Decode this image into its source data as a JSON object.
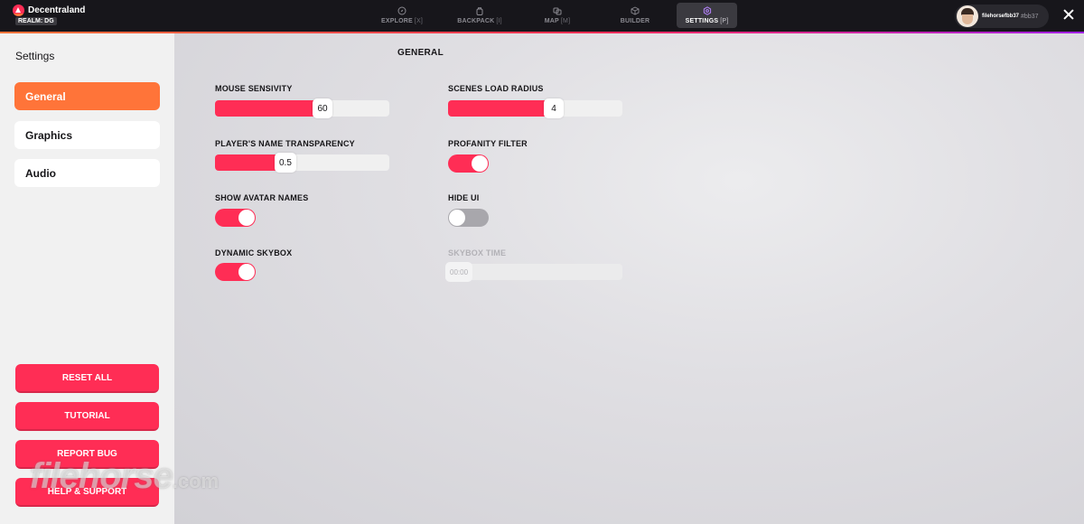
{
  "topbar": {
    "app_name": "Decentraland",
    "realm": "REALM: DG",
    "tabs": [
      {
        "label": "EXPLORE",
        "hotkey": "[X]",
        "icon": "compass-icon"
      },
      {
        "label": "BACKPACK",
        "hotkey": "[I]",
        "icon": "backpack-icon"
      },
      {
        "label": "MAP",
        "hotkey": "[M]",
        "icon": "map-icon"
      },
      {
        "label": "BUILDER",
        "hotkey": "",
        "icon": "cube-icon"
      },
      {
        "label": "SETTINGS",
        "hotkey": "[P]",
        "icon": "gear-icon",
        "active": true
      }
    ],
    "user": {
      "name": "filehorsefbb37",
      "tag": "#bb37"
    }
  },
  "sidebar": {
    "title": "Settings",
    "items": [
      {
        "label": "General",
        "active": true
      },
      {
        "label": "Graphics"
      },
      {
        "label": "Audio"
      }
    ],
    "buttons": {
      "reset_all": "RESET ALL",
      "tutorial": "TUTORIAL",
      "report_bug": "REPORT BUG",
      "help_support": "HELP & SUPPORT"
    }
  },
  "general": {
    "title": "GENERAL",
    "mouse_sensivity": {
      "label": "MOUSE SENSIVITY",
      "value": "60",
      "fraction": 0.57
    },
    "scenes_load_radius": {
      "label": "SCENES LOAD RADIUS",
      "value": "4",
      "fraction": 0.56
    },
    "name_transparency": {
      "label": "PLAYER'S NAME TRANSPARENCY",
      "value": "0.5",
      "fraction": 0.35
    },
    "profanity_filter": {
      "label": "PROFANITY FILTER",
      "on": true
    },
    "show_avatar_names": {
      "label": "SHOW AVATAR NAMES",
      "on": true
    },
    "hide_ui": {
      "label": "HIDE UI",
      "on": false
    },
    "dynamic_skybox": {
      "label": "DYNAMIC SKYBOX",
      "on": true
    },
    "skybox_time": {
      "label": "SKYBOX TIME",
      "value": "00:00",
      "disabled": true
    }
  },
  "watermark": {
    "main": "filehorse",
    "sub": ".com"
  },
  "colors": {
    "accent": "#ff2d55",
    "active_tab": "#ff7439",
    "topbar": "#17161b"
  }
}
